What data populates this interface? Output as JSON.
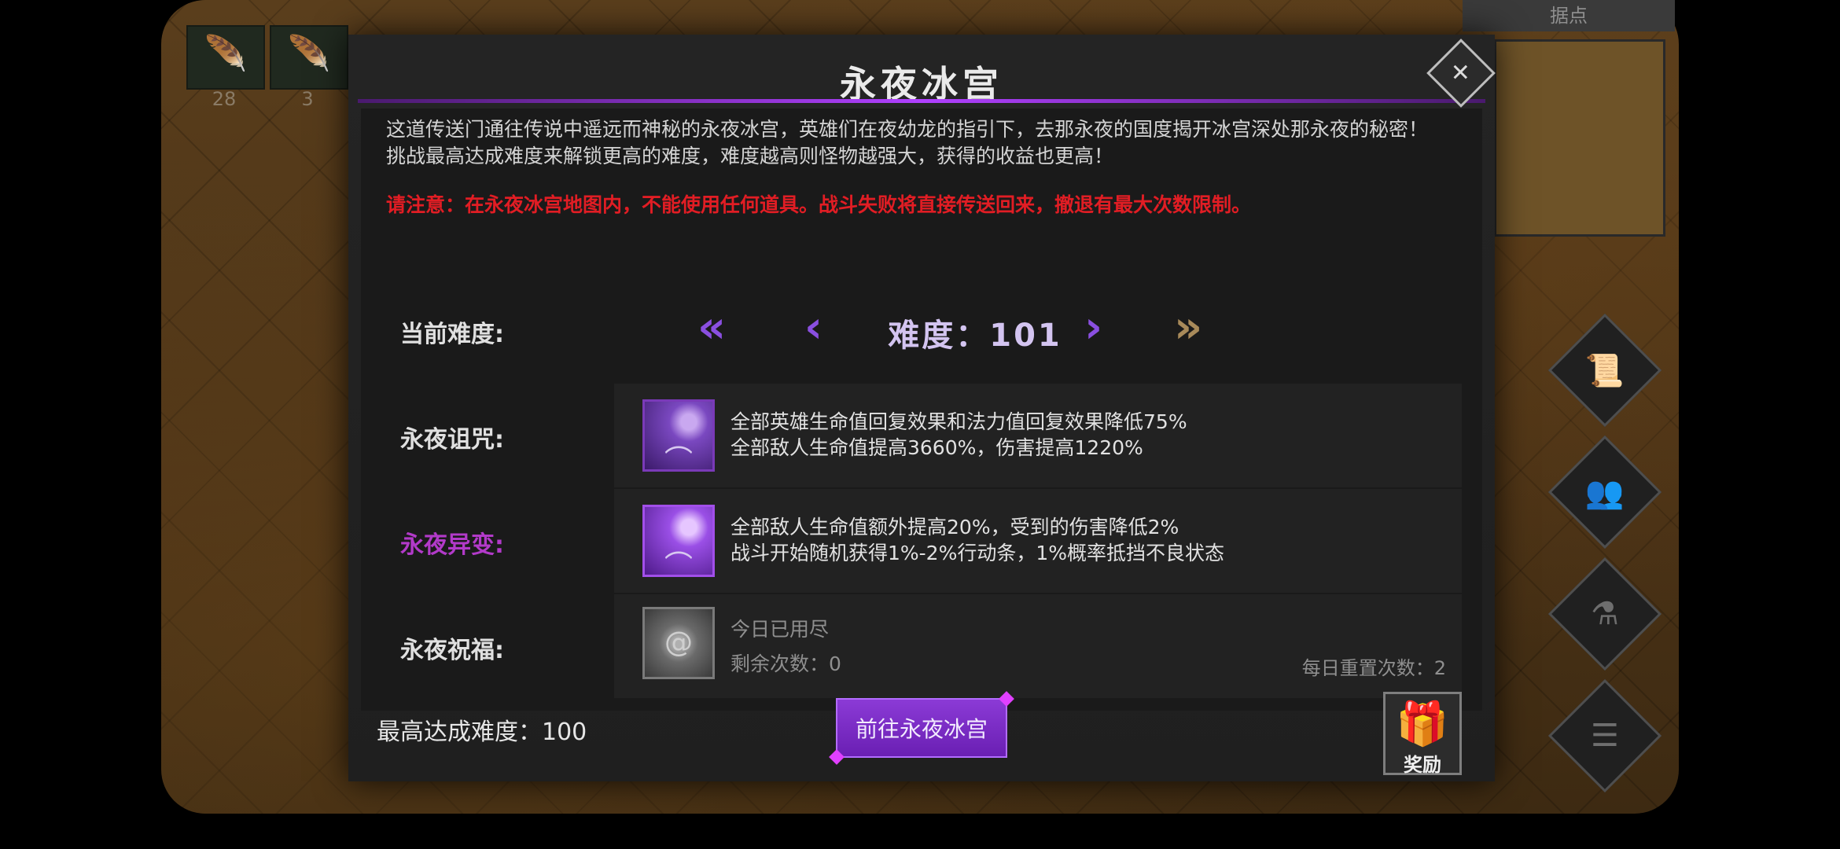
{
  "game": {
    "top_items": [
      {
        "icon": "green-feather-icon",
        "glyph": "🪶",
        "count": "28"
      },
      {
        "icon": "purple-feather-icon",
        "glyph": "🪶",
        "count": "3"
      }
    ],
    "minimap": {
      "title": "据点"
    },
    "side_buttons": [
      {
        "icon": "scroll-icon",
        "glyph": "📜"
      },
      {
        "icon": "heroes-icon",
        "glyph": "👥"
      },
      {
        "icon": "potion-icon",
        "glyph": "⚗"
      },
      {
        "icon": "list-icon",
        "glyph": "☰"
      }
    ]
  },
  "dialog": {
    "title": "永夜冰宫",
    "close_glyph": "✕",
    "description": [
      "这道传送门通往传说中遥远而神秘的永夜冰宫，英雄们在夜幼龙的指引下，去那永夜的国度揭开冰宫深处那永夜的秘密！",
      "挑战最高达成难度来解锁更高的难度，难度越高则怪物越强大，获得的收益也更高！"
    ],
    "warning": "请注意：在永夜冰宫地图内，不能使用任何道具。战斗失败将直接传送回来，撤退有最大次数限制。",
    "difficulty": {
      "label": "当前难度:",
      "value": "难度：101",
      "prev_fast": "«",
      "prev": "‹",
      "next": "›",
      "next_fast": "»"
    },
    "curse": {
      "label": "永夜诅咒:",
      "icon": "bat-moon-icon",
      "lines": [
        "全部英雄生命值回复效果和法力值回复效果降低75%",
        "全部敌人生命值提高3660%，伤害提高1220%"
      ]
    },
    "mutation": {
      "label": "永夜异变:",
      "icon": "bat-moon-icon",
      "lines": [
        "全部敌人生命值额外提高20%，受到的伤害降低2%",
        "战斗开始随机获得1%-2%行动条，1%概率抵挡不良状态"
      ]
    },
    "blessing": {
      "label": "永夜祝福:",
      "icon": "vortex-icon",
      "status": "今日已用尽",
      "remaining": "剩余次数：0",
      "daily_reset": "每日重置次数：2"
    },
    "best_difficulty": "最高达成难度：100",
    "go_button": "前往永夜冰宫",
    "reward": {
      "label": "奖励",
      "icon": "gift-icon"
    }
  }
}
